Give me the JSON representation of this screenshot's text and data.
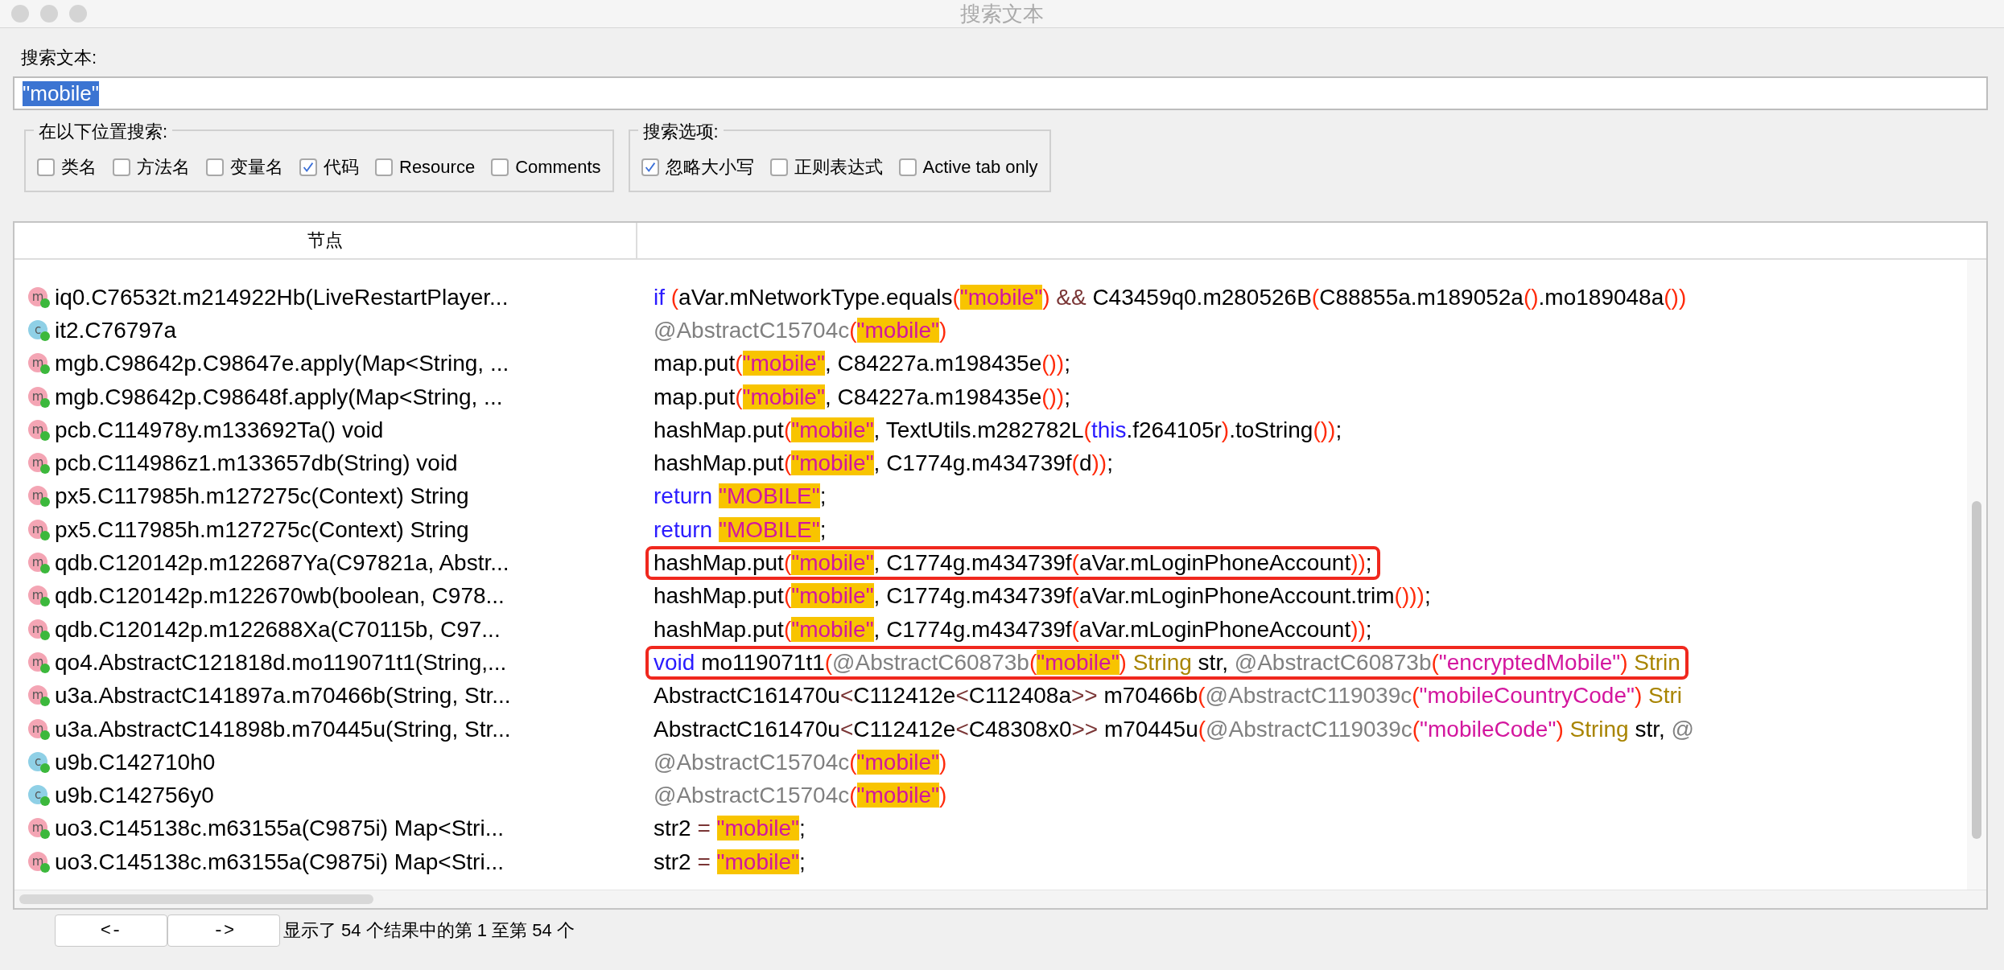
{
  "window": {
    "title": "搜索文本"
  },
  "search": {
    "label": "搜索文本:",
    "value": "\"mobile\"",
    "text_selected": true
  },
  "scope_group": {
    "title": "在以下位置搜索:",
    "options": [
      {
        "label": "类名",
        "checked": false
      },
      {
        "label": "方法名",
        "checked": false
      },
      {
        "label": "变量名",
        "checked": false
      },
      {
        "label": "代码",
        "checked": true
      },
      {
        "label": "Resource",
        "checked": false
      },
      {
        "label": "Comments",
        "checked": false
      }
    ]
  },
  "options_group": {
    "title": "搜索选项:",
    "options": [
      {
        "label": "忽略大小写",
        "checked": true
      },
      {
        "label": "正则表达式",
        "checked": false
      },
      {
        "label": "Active tab only",
        "checked": false
      }
    ]
  },
  "table": {
    "columns": [
      "节点"
    ],
    "rows": [
      {
        "kind": "method",
        "icon": "m",
        "node": "iq0.C76532t.m214922Hb(LiveRestartPlayer...",
        "outlined": false,
        "code": [
          {
            "kind": "keyword",
            "text": "if "
          },
          {
            "kind": "paren",
            "text": "("
          },
          {
            "kind": "plain",
            "text": "aVar.mNetworkType.equals"
          },
          {
            "kind": "paren",
            "text": "("
          },
          {
            "kind": "match",
            "text": "\"mobile\""
          },
          {
            "kind": "paren",
            "text": ")"
          },
          {
            "kind": "op",
            "text": " && "
          },
          {
            "kind": "plain",
            "text": "C43459q0.m280526B"
          },
          {
            "kind": "paren",
            "text": "("
          },
          {
            "kind": "plain",
            "text": "C88855a.m189052a"
          },
          {
            "kind": "paren",
            "text": "()"
          },
          {
            "kind": "plain",
            "text": ".mo189048a"
          },
          {
            "kind": "paren",
            "text": "())"
          }
        ]
      },
      {
        "kind": "class",
        "icon": "c",
        "node": "it2.C76797a",
        "outlined": false,
        "code": [
          {
            "kind": "annotation",
            "text": "@AbstractC15704c"
          },
          {
            "kind": "paren",
            "text": "("
          },
          {
            "kind": "match",
            "text": "\"mobile\""
          },
          {
            "kind": "paren",
            "text": ")"
          }
        ]
      },
      {
        "kind": "method",
        "icon": "m",
        "node": "mgb.C98642p.C98647e.apply(Map<String, ...",
        "outlined": false,
        "code": [
          {
            "kind": "plain",
            "text": "map.put"
          },
          {
            "kind": "paren",
            "text": "("
          },
          {
            "kind": "match",
            "text": "\"mobile\""
          },
          {
            "kind": "plain",
            "text": ", C84227a.m198435e"
          },
          {
            "kind": "paren",
            "text": "())"
          },
          {
            "kind": "plain",
            "text": ";"
          }
        ]
      },
      {
        "kind": "method",
        "icon": "m",
        "node": "mgb.C98642p.C98648f.apply(Map<String, ...",
        "outlined": false,
        "code": [
          {
            "kind": "plain",
            "text": "map.put"
          },
          {
            "kind": "paren",
            "text": "("
          },
          {
            "kind": "match",
            "text": "\"mobile\""
          },
          {
            "kind": "plain",
            "text": ", C84227a.m198435e"
          },
          {
            "kind": "paren",
            "text": "())"
          },
          {
            "kind": "plain",
            "text": ";"
          }
        ]
      },
      {
        "kind": "method",
        "icon": "m",
        "node": "pcb.C114978y.m133692Ta() void",
        "outlined": false,
        "code": [
          {
            "kind": "plain",
            "text": "hashMap.put"
          },
          {
            "kind": "paren",
            "text": "("
          },
          {
            "kind": "match",
            "text": "\"mobile\""
          },
          {
            "kind": "plain",
            "text": ", TextUtils.m282782L"
          },
          {
            "kind": "paren",
            "text": "("
          },
          {
            "kind": "keyword",
            "text": "this"
          },
          {
            "kind": "plain",
            "text": ".f264105r"
          },
          {
            "kind": "paren",
            "text": ")"
          },
          {
            "kind": "plain",
            "text": ".toString"
          },
          {
            "kind": "paren",
            "text": "())"
          },
          {
            "kind": "plain",
            "text": ";"
          }
        ]
      },
      {
        "kind": "method",
        "icon": "m",
        "node": "pcb.C114986z1.m133657db(String) void",
        "outlined": false,
        "code": [
          {
            "kind": "plain",
            "text": "hashMap.put"
          },
          {
            "kind": "paren",
            "text": "("
          },
          {
            "kind": "match",
            "text": "\"mobile\""
          },
          {
            "kind": "plain",
            "text": ", C1774g.m434739f"
          },
          {
            "kind": "paren",
            "text": "("
          },
          {
            "kind": "plain",
            "text": "d"
          },
          {
            "kind": "paren",
            "text": "))"
          },
          {
            "kind": "plain",
            "text": ";"
          }
        ]
      },
      {
        "kind": "method",
        "icon": "m",
        "node": "px5.C117985h.m127275c(Context) String",
        "outlined": false,
        "code": [
          {
            "kind": "keyword",
            "text": "return "
          },
          {
            "kind": "match",
            "text": "\"MOBILE\""
          },
          {
            "kind": "plain",
            "text": ";"
          }
        ]
      },
      {
        "kind": "method",
        "icon": "m",
        "node": "px5.C117985h.m127275c(Context) String",
        "outlined": false,
        "code": [
          {
            "kind": "keyword",
            "text": "return "
          },
          {
            "kind": "match",
            "text": "\"MOBILE\""
          },
          {
            "kind": "plain",
            "text": ";"
          }
        ]
      },
      {
        "kind": "method",
        "icon": "m",
        "node": "qdb.C120142p.m122687Ya(C97821a, Abstr...",
        "outlined": true,
        "code": [
          {
            "kind": "plain",
            "text": "hashMap.put"
          },
          {
            "kind": "paren",
            "text": "("
          },
          {
            "kind": "match",
            "text": "\"mobile\""
          },
          {
            "kind": "plain",
            "text": ", C1774g.m434739f"
          },
          {
            "kind": "paren",
            "text": "("
          },
          {
            "kind": "plain",
            "text": "aVar.mLoginPhoneAccount"
          },
          {
            "kind": "paren",
            "text": "))"
          },
          {
            "kind": "plain",
            "text": ";"
          }
        ]
      },
      {
        "kind": "method",
        "icon": "m",
        "node": "qdb.C120142p.m122670wb(boolean, C978...",
        "outlined": false,
        "code": [
          {
            "kind": "plain",
            "text": "hashMap.put"
          },
          {
            "kind": "paren",
            "text": "("
          },
          {
            "kind": "match",
            "text": "\"mobile\""
          },
          {
            "kind": "plain",
            "text": ", C1774g.m434739f"
          },
          {
            "kind": "paren",
            "text": "("
          },
          {
            "kind": "plain",
            "text": "aVar.mLoginPhoneAccount.trim"
          },
          {
            "kind": "paren",
            "text": "()))"
          },
          {
            "kind": "plain",
            "text": ";"
          }
        ]
      },
      {
        "kind": "method",
        "icon": "m",
        "node": "qdb.C120142p.m122688Xa(C70115b, C97...",
        "outlined": false,
        "code": [
          {
            "kind": "plain",
            "text": "hashMap.put"
          },
          {
            "kind": "paren",
            "text": "("
          },
          {
            "kind": "match",
            "text": "\"mobile\""
          },
          {
            "kind": "plain",
            "text": ", C1774g.m434739f"
          },
          {
            "kind": "paren",
            "text": "("
          },
          {
            "kind": "plain",
            "text": "aVar.mLoginPhoneAccount"
          },
          {
            "kind": "paren",
            "text": "))"
          },
          {
            "kind": "plain",
            "text": ";"
          }
        ]
      },
      {
        "kind": "method",
        "icon": "m",
        "node": "qo4.AbstractC121818d.mo119071t1(String,...",
        "outlined": true,
        "code": [
          {
            "kind": "keyword",
            "text": "void "
          },
          {
            "kind": "plain",
            "text": "mo119071t1"
          },
          {
            "kind": "paren",
            "text": "("
          },
          {
            "kind": "annotation",
            "text": "@AbstractC60873b"
          },
          {
            "kind": "paren",
            "text": "("
          },
          {
            "kind": "match",
            "text": "\"mobile\""
          },
          {
            "kind": "paren",
            "text": ")"
          },
          {
            "kind": "type",
            "text": " String "
          },
          {
            "kind": "plain",
            "text": "str, "
          },
          {
            "kind": "annotation",
            "text": "@AbstractC60873b"
          },
          {
            "kind": "paren",
            "text": "("
          },
          {
            "kind": "string",
            "text": "\"encryptedMobile\""
          },
          {
            "kind": "paren",
            "text": ")"
          },
          {
            "kind": "type",
            "text": " Strin"
          }
        ]
      },
      {
        "kind": "method",
        "icon": "m",
        "node": "u3a.AbstractC141897a.m70466b(String, Str...",
        "outlined": false,
        "code": [
          {
            "kind": "plain",
            "text": "AbstractC161470u"
          },
          {
            "kind": "op",
            "text": "<"
          },
          {
            "kind": "plain",
            "text": "C112412e"
          },
          {
            "kind": "op",
            "text": "<"
          },
          {
            "kind": "plain",
            "text": "C112408a"
          },
          {
            "kind": "op",
            "text": ">>"
          },
          {
            "kind": "plain",
            "text": " m70466b"
          },
          {
            "kind": "paren",
            "text": "("
          },
          {
            "kind": "annotation",
            "text": "@AbstractC119039c"
          },
          {
            "kind": "paren",
            "text": "("
          },
          {
            "kind": "string",
            "text": "\"mobileCountryCode\""
          },
          {
            "kind": "paren",
            "text": ")"
          },
          {
            "kind": "type",
            "text": " Stri"
          }
        ]
      },
      {
        "kind": "method",
        "icon": "m",
        "node": "u3a.AbstractC141898b.m70445u(String, Str...",
        "outlined": false,
        "code": [
          {
            "kind": "plain",
            "text": "AbstractC161470u"
          },
          {
            "kind": "op",
            "text": "<"
          },
          {
            "kind": "plain",
            "text": "C112412e"
          },
          {
            "kind": "op",
            "text": "<"
          },
          {
            "kind": "plain",
            "text": "C48308x0"
          },
          {
            "kind": "op",
            "text": ">>"
          },
          {
            "kind": "plain",
            "text": " m70445u"
          },
          {
            "kind": "paren",
            "text": "("
          },
          {
            "kind": "annotation",
            "text": "@AbstractC119039c"
          },
          {
            "kind": "paren",
            "text": "("
          },
          {
            "kind": "string",
            "text": "\"mobileCode\""
          },
          {
            "kind": "paren",
            "text": ")"
          },
          {
            "kind": "type",
            "text": " String "
          },
          {
            "kind": "plain",
            "text": "str, "
          },
          {
            "kind": "annotation",
            "text": "@"
          }
        ]
      },
      {
        "kind": "class",
        "icon": "c",
        "node": "u9b.C142710h0",
        "outlined": false,
        "code": [
          {
            "kind": "annotation",
            "text": "@AbstractC15704c"
          },
          {
            "kind": "paren",
            "text": "("
          },
          {
            "kind": "match",
            "text": "\"mobile\""
          },
          {
            "kind": "paren",
            "text": ")"
          }
        ]
      },
      {
        "kind": "class",
        "icon": "c",
        "node": "u9b.C142756y0",
        "outlined": false,
        "code": [
          {
            "kind": "annotation",
            "text": "@AbstractC15704c"
          },
          {
            "kind": "paren",
            "text": "("
          },
          {
            "kind": "match",
            "text": "\"mobile\""
          },
          {
            "kind": "paren",
            "text": ")"
          }
        ]
      },
      {
        "kind": "method",
        "icon": "m",
        "node": "uo3.C145138c.m63155a(C9875i) Map<Stri...",
        "outlined": false,
        "code": [
          {
            "kind": "plain",
            "text": "str2"
          },
          {
            "kind": "op",
            "text": " = "
          },
          {
            "kind": "match",
            "text": "\"mobile\""
          },
          {
            "kind": "plain",
            "text": ";"
          }
        ]
      },
      {
        "kind": "method",
        "icon": "m",
        "node": "uo3.C145138c.m63155a(C9875i) Map<Stri...",
        "outlined": false,
        "code": [
          {
            "kind": "plain",
            "text": "str2"
          },
          {
            "kind": "op",
            "text": " = "
          },
          {
            "kind": "match",
            "text": "\"mobile\""
          },
          {
            "kind": "plain",
            "text": ";"
          }
        ]
      }
    ]
  },
  "footer": {
    "buttons": [
      "<-",
      "->"
    ],
    "status": "显示了 54 个结果中的第 1 至第 54 个"
  }
}
